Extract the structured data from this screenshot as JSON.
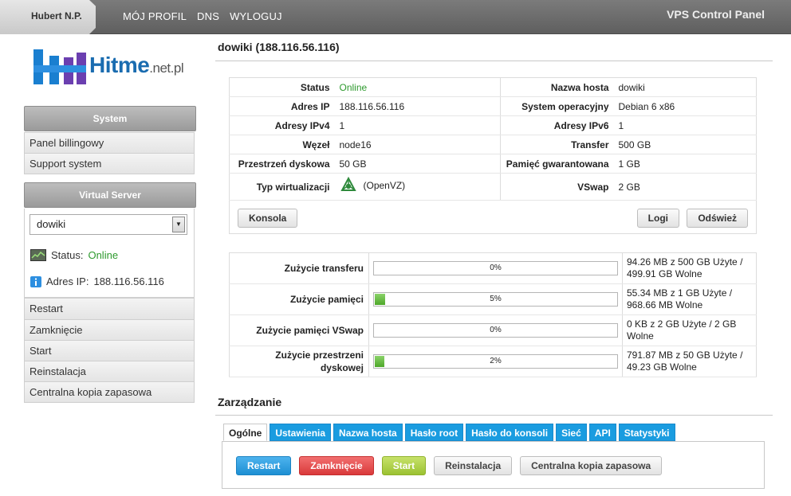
{
  "header": {
    "user": "Hubert N.P.",
    "nav": [
      "MÓJ PROFIL",
      "DNS",
      "WYLOGUJ"
    ],
    "panel_title": "VPS Control Panel"
  },
  "logo": {
    "brand": "Hitme",
    "suffix": ".net.pl"
  },
  "sidebar": {
    "system_title": "System",
    "system_items": [
      "Panel billingowy",
      "Support system"
    ],
    "vs_title": "Virtual Server",
    "server_select": "dowiki",
    "status_label": "Status:",
    "status_value": "Online",
    "ip_label": "Adres IP:",
    "ip_value": "188.116.56.116",
    "vs_items": [
      "Restart",
      "Zamknięcie",
      "Start",
      "Reinstalacja",
      "Centralna kopia zapasowa"
    ]
  },
  "main": {
    "title": "dowiki (188.116.56.116)",
    "info": [
      {
        "k1": "Status",
        "v1": "Online",
        "k2": "Nazwa hosta",
        "v2": "dowiki"
      },
      {
        "k1": "Adres IP",
        "v1": "188.116.56.116",
        "k2": "System operacyjny",
        "v2": "Debian 6 x86"
      },
      {
        "k1": "Adresy IPv4",
        "v1": "1",
        "k2": "Adresy IPv6",
        "v2": "1"
      },
      {
        "k1": "Węzeł",
        "v1": "node16",
        "k2": "Transfer",
        "v2": "500 GB"
      },
      {
        "k1": "Przestrzeń dyskowa",
        "v1": "50 GB",
        "k2": "Pamięć gwarantowana",
        "v2": "1 GB"
      },
      {
        "k1": "Typ wirtualizacji",
        "v1": "(OpenVZ)",
        "k2": "VSwap",
        "v2": "2 GB"
      }
    ],
    "buttons": {
      "console": "Konsola",
      "logs": "Logi",
      "refresh": "Odśwież"
    },
    "usage": [
      {
        "label": "Zużycie transferu",
        "pct": 0,
        "pct_text": "0%",
        "detail": "94.26 MB z 500 GB Użyte / 499.91 GB Wolne"
      },
      {
        "label": "Zużycie pamięci",
        "pct": 5,
        "pct_text": "5%",
        "detail": "55.34 MB z 1 GB Użyte / 968.66 MB Wolne"
      },
      {
        "label": "Zużycie pamięci VSwap",
        "pct": 0,
        "pct_text": "0%",
        "detail": "0 KB z 2 GB Użyte / 2 GB Wolne"
      },
      {
        "label": "Zużycie przestrzeni dyskowej",
        "pct": 2,
        "pct_text": "2%",
        "detail": "791.87 MB z 50 GB Użyte / 49.23 GB Wolne"
      }
    ],
    "manage_title": "Zarządzanie",
    "tabs": [
      "Ogólne",
      "Ustawienia",
      "Nazwa hosta",
      "Hasło root",
      "Hasło do konsoli",
      "Sieć",
      "API",
      "Statystyki"
    ],
    "actions": [
      {
        "label": "Restart",
        "style": "blue"
      },
      {
        "label": "Zamknięcie",
        "style": "red"
      },
      {
        "label": "Start",
        "style": "lime"
      },
      {
        "label": "Reinstalacja",
        "style": "gray"
      },
      {
        "label": "Centralna kopia zapasowa",
        "style": "gray"
      }
    ]
  }
}
